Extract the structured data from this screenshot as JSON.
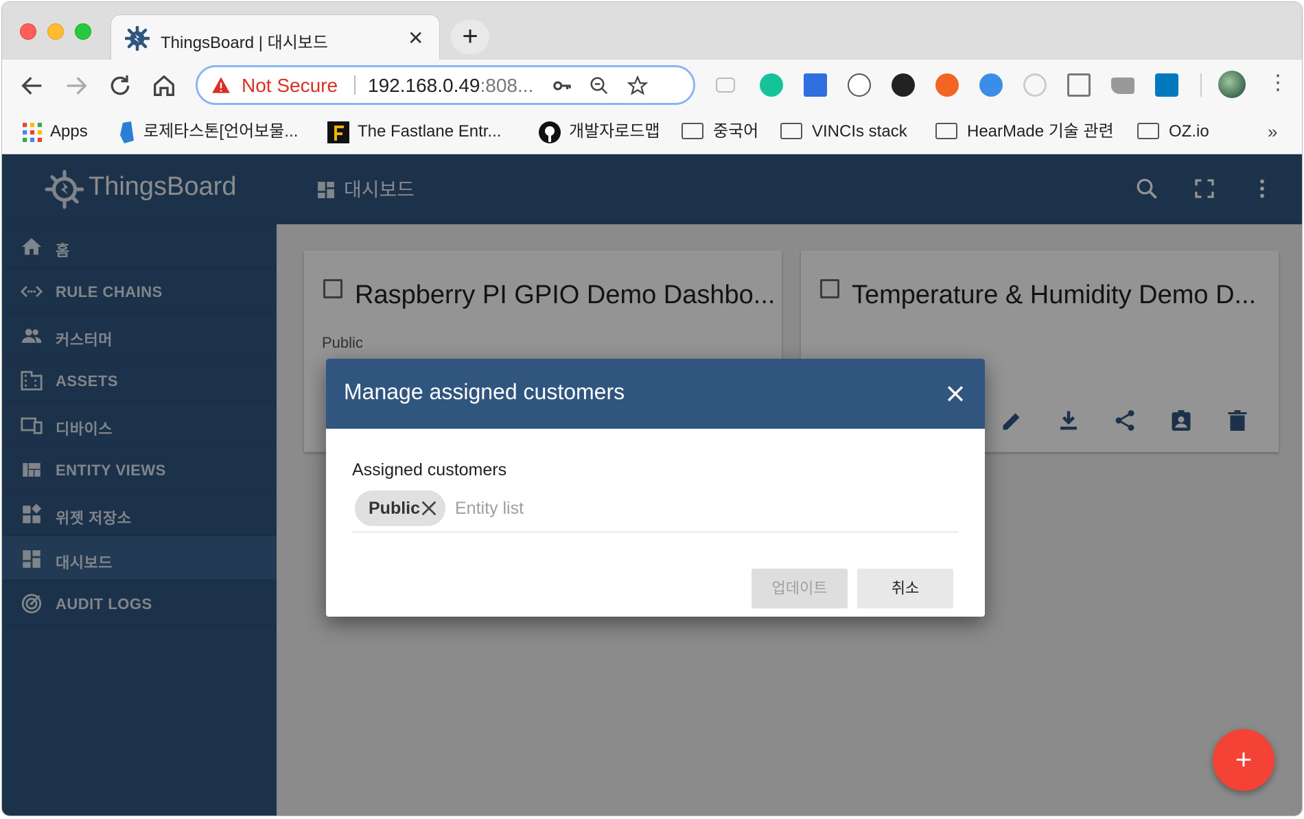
{
  "browser": {
    "tab_title": "ThingsBoard | 대시보드",
    "tab_close": "✕",
    "new_tab": "+",
    "security_label": "Not Secure",
    "url_host": "192.168.0.49",
    "url_rest": ":808...",
    "menu": "⋮"
  },
  "bookmarks": [
    {
      "label": "Apps",
      "icon": "apps-grid-icon"
    },
    {
      "label": "로제타스톤[언어보물...",
      "icon": "rosetta-icon"
    },
    {
      "label": "The Fastlane Entr...",
      "icon": "fastlane-icon"
    },
    {
      "label": "개발자로드맵",
      "icon": "github-icon"
    },
    {
      "label": "중국어",
      "icon": "folder-icon"
    },
    {
      "label": "VINCIs stack",
      "icon": "folder-icon"
    },
    {
      "label": "HearMade 기술 관련",
      "icon": "folder-icon"
    },
    {
      "label": "OZ.io",
      "icon": "folder-icon"
    }
  ],
  "bookmarks_more": "»",
  "app": {
    "logo": "ThingsBoard",
    "breadcrumb": "대시보드",
    "sidebar": [
      {
        "label": "홈",
        "icon": "home-icon"
      },
      {
        "label": "RULE CHAINS",
        "icon": "code-arrows-icon"
      },
      {
        "label": "커스터머",
        "icon": "people-icon"
      },
      {
        "label": "ASSETS",
        "icon": "building-icon"
      },
      {
        "label": "디바이스",
        "icon": "devices-icon"
      },
      {
        "label": "ENTITY VIEWS",
        "icon": "view-quilt-icon"
      },
      {
        "label": "위젯 저장소",
        "icon": "widgets-icon"
      },
      {
        "label": "대시보드",
        "icon": "dashboard-icon"
      },
      {
        "label": "AUDIT LOGS",
        "icon": "track-changes-icon"
      }
    ],
    "active_item": "대시보드",
    "cards": [
      {
        "title": "Raspberry PI GPIO Demo Dashbo...",
        "subtitle": "Public"
      },
      {
        "title": "Temperature & Humidity Demo D...",
        "subtitle": ""
      }
    ],
    "fab_label": "+"
  },
  "dialog": {
    "title": "Manage assigned customers",
    "field_label": "Assigned customers",
    "chips": [
      "Public"
    ],
    "input_placeholder": "Entity list",
    "update_button": "업데이트",
    "cancel_button": "취소"
  },
  "colors": {
    "primary": "#305680",
    "accent": "#f44336",
    "warning": "#d93025"
  }
}
